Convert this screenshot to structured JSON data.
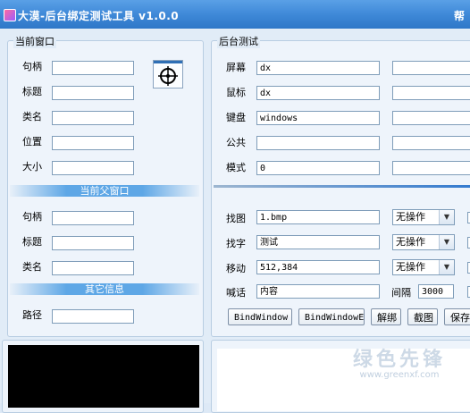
{
  "window": {
    "title": "大漠-后台绑定测试工具 v1.0.0",
    "help": "帮"
  },
  "current_window": {
    "legend": "当前窗口",
    "fields": [
      {
        "label": "句柄",
        "value": ""
      },
      {
        "label": "标题",
        "value": ""
      },
      {
        "label": "类名",
        "value": ""
      },
      {
        "label": "位置",
        "value": ""
      },
      {
        "label": "大小",
        "value": ""
      }
    ],
    "target_icon": "crosshair-target-icon"
  },
  "parent_window": {
    "header": "当前父窗口",
    "fields": [
      {
        "label": "句柄",
        "value": ""
      },
      {
        "label": "标题",
        "value": ""
      },
      {
        "label": "类名",
        "value": ""
      }
    ]
  },
  "other_info": {
    "header": "其它信息",
    "fields": [
      {
        "label": "路径",
        "value": ""
      }
    ]
  },
  "backend_test": {
    "legend": "后台测试",
    "fields": [
      {
        "label": "屏幕",
        "value": "dx",
        "extra": ""
      },
      {
        "label": "鼠标",
        "value": "dx",
        "extra": ""
      },
      {
        "label": "键盘",
        "value": "windows",
        "extra": ""
      },
      {
        "label": "公共",
        "value": "",
        "extra": ""
      },
      {
        "label": "模式",
        "value": "0",
        "extra": ""
      }
    ],
    "actions": [
      {
        "label": "找图",
        "value": "1.bmp",
        "op": "无操作"
      },
      {
        "label": "找字",
        "value": "测试",
        "op": "无操作"
      },
      {
        "label": "移动",
        "value": "512,384",
        "op": "无操作"
      }
    ],
    "say": {
      "label": "喊话",
      "value": "内容",
      "interval_label": "间隔",
      "interval_value": "3000"
    },
    "buttons": {
      "bind": "BindWindow",
      "bind_ex": "BindWindowEx",
      "unbind": "解绑",
      "capture": "截图",
      "save": "保存"
    }
  },
  "watermark": {
    "main": "绿色先锋",
    "url": "www.greenxf.com"
  },
  "colors": {
    "titlebar": "#3f89d8",
    "section_header": "#5ea7e6",
    "background": "#e1ecf7"
  }
}
